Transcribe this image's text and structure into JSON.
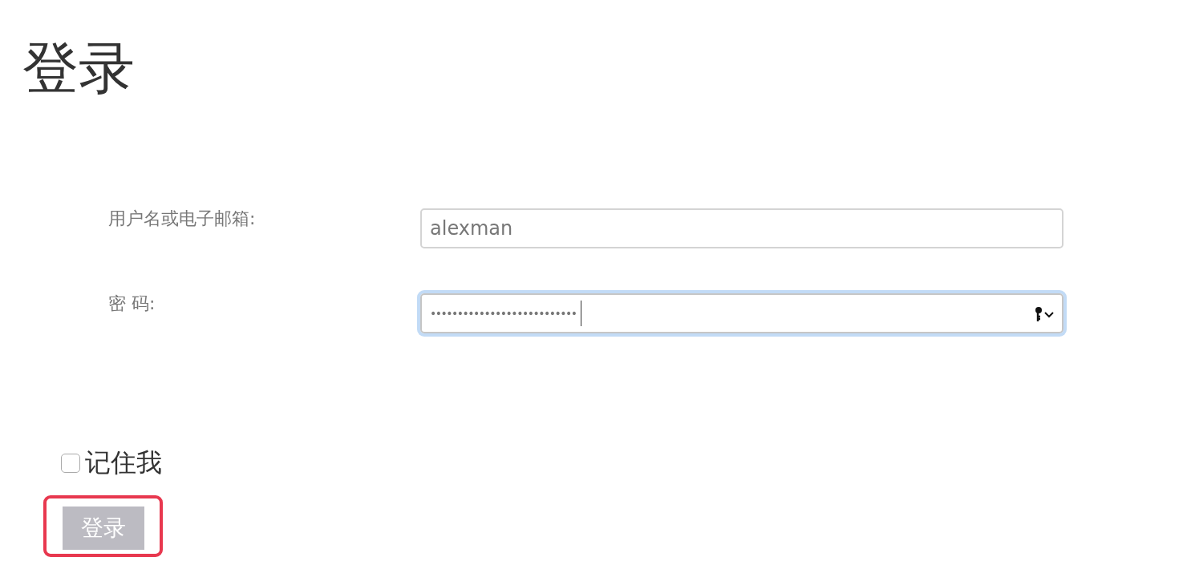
{
  "title": "登录",
  "fields": [
    {
      "label": "用户名或电子邮箱:",
      "kind": "text",
      "value": "alexman",
      "focused": false
    },
    {
      "label": "密 码:",
      "kind": "password",
      "value": "•••••••••••••••••••••••••••",
      "focused": true
    }
  ],
  "remember": {
    "label": "记住我",
    "checked": false
  },
  "submit": {
    "label": "登录",
    "highlighted": true
  }
}
